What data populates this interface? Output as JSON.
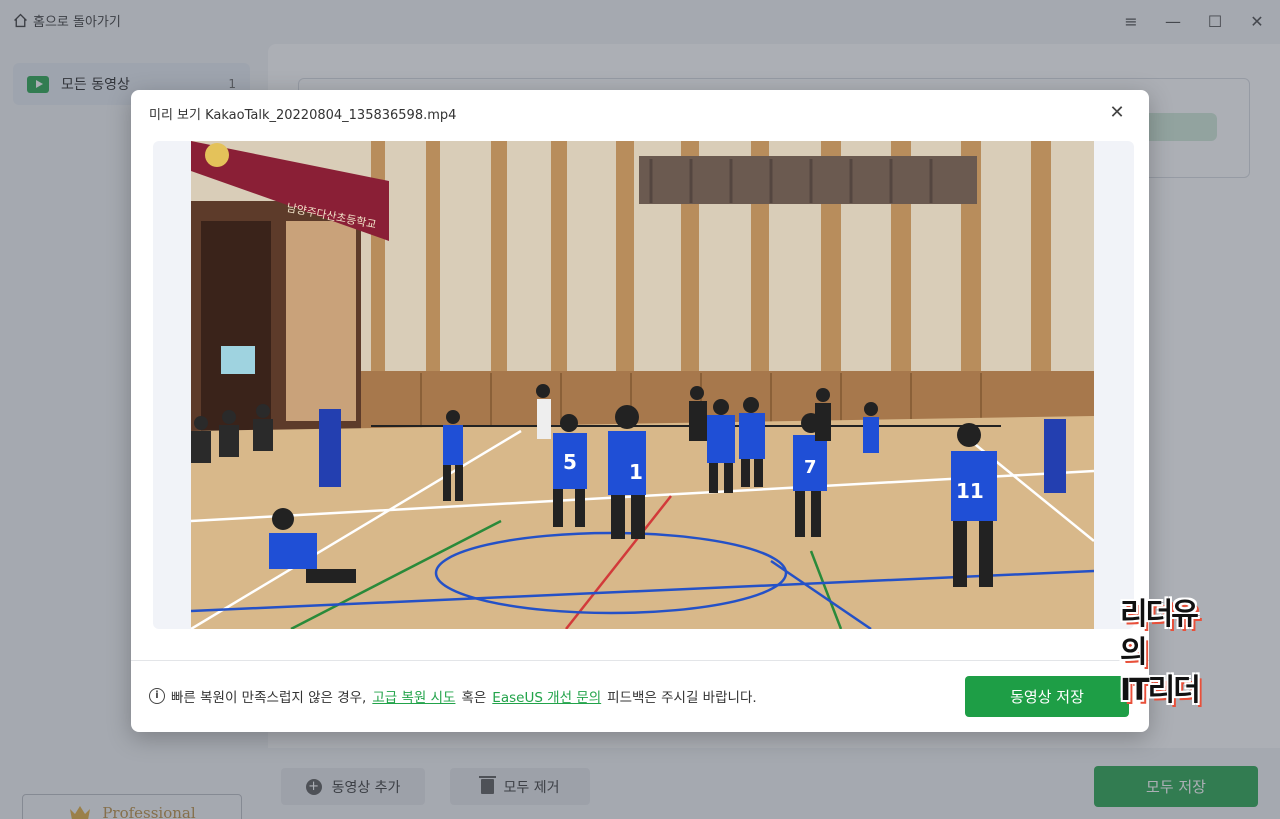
{
  "header": {
    "home_label": "홈으로 돌아가기"
  },
  "sidebar": {
    "items": [
      {
        "label": "모든 동영상",
        "count": "1"
      }
    ],
    "professional_label": "Professional"
  },
  "toolbar": {
    "add_video_label": "동영상 추가",
    "remove_all_label": "모두 제거",
    "save_all_label": "모두 저장"
  },
  "dialog": {
    "title": "미리 보기 KakaoTalk_20220804_135836598.mp4",
    "footer": {
      "text_before": "빠른 복원이 만족스럽지 않은 경우,",
      "link_advanced": "고급 복원 시도",
      "text_middle": "혹은",
      "link_feedback": "EaseUS 개선 문의",
      "text_after": "피드백은 주시길 바랍니다."
    },
    "save_label": "동영상 저장"
  },
  "video": {
    "banner_text": "남양주다산초등학교",
    "jersey_numbers": [
      "5",
      "1",
      "7",
      "11"
    ]
  },
  "watermark": {
    "line1": "리더유의",
    "line2": "IT리더"
  },
  "colors": {
    "accent": "#22a34a",
    "pro_gold": "#b98b3e",
    "jersey_blue": "#1f4fd6",
    "banner_red": "#8a1f36"
  }
}
